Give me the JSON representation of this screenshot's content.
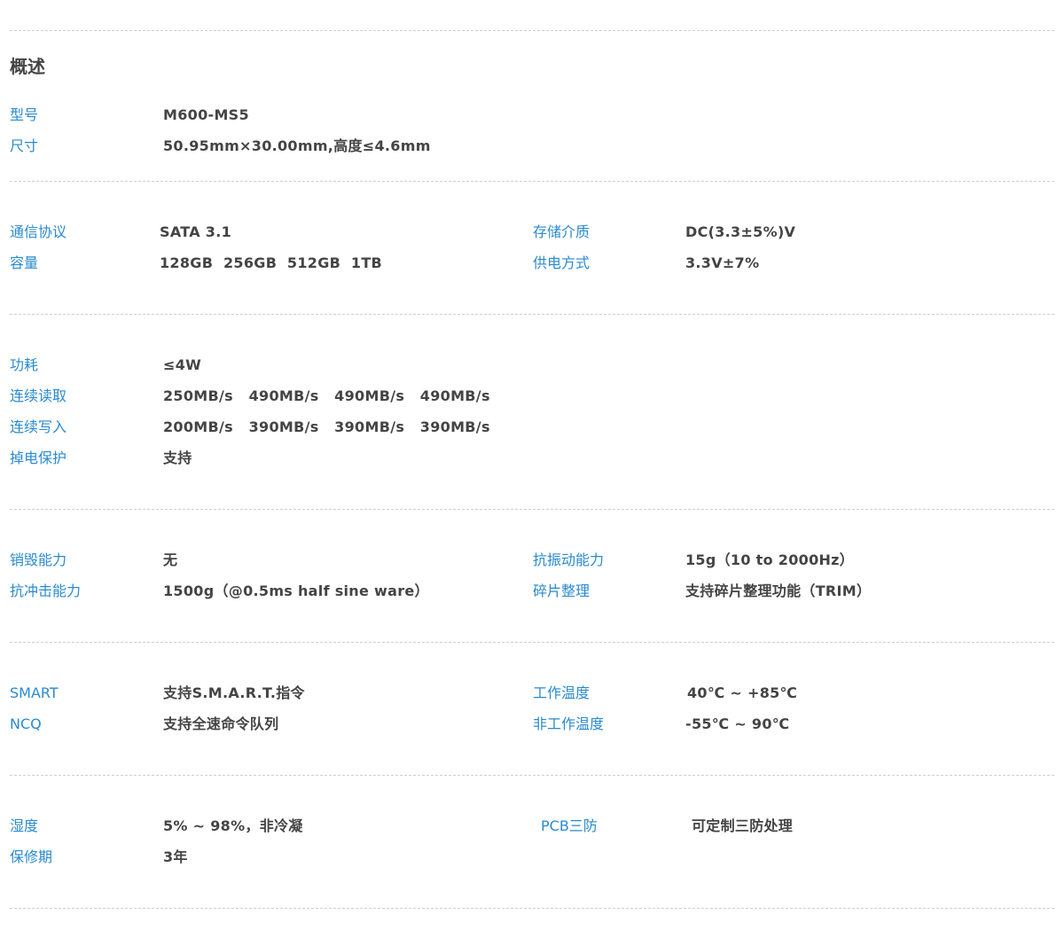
{
  "title": "概述",
  "colors": {
    "label": "#2a8ad0",
    "value": "#444444",
    "divider": "#cfcfcf"
  },
  "sections": [
    {
      "rows": [
        {
          "label": "型号",
          "value": "M600-MS5"
        },
        {
          "label": "尺寸",
          "value": "50.95mm×30.00mm,高度≤4.6mm"
        }
      ]
    },
    {
      "rows": [
        {
          "label": "通信协议",
          "value": "SATA 3.1"
        },
        {
          "label": "容量",
          "value": "128GB  256GB  512GB  1TB"
        }
      ],
      "right": [
        {
          "label": "存储介质",
          "value": "DC(3.3±5%)V"
        },
        {
          "label": "供电方式",
          "value": "3.3V±7%"
        }
      ]
    },
    {
      "rows": [
        {
          "label": "功耗",
          "value": "≤4W"
        },
        {
          "label": "连续读取",
          "value": "250MB/s   490MB/s   490MB/s   490MB/s"
        },
        {
          "label": "连续写入",
          "value": "200MB/s   390MB/s   390MB/s   390MB/s"
        },
        {
          "label": "掉电保护",
          "value": "支持"
        }
      ]
    },
    {
      "rows": [
        {
          "label": "销毁能力",
          "value": "无"
        },
        {
          "label": "抗冲击能力",
          "value": "1500g（@0.5ms half sine ware）"
        }
      ],
      "right": [
        {
          "label": "抗振动能力",
          "value": "15g（10 to 2000Hz）"
        },
        {
          "label": "碎片整理",
          "value": "支持碎片整理功能（TRIM）"
        }
      ]
    },
    {
      "rows": [
        {
          "label": "SMART",
          "value": "支持S.M.A.R.T.指令"
        },
        {
          "label": "NCQ",
          "value": "支持全速命令队列"
        }
      ],
      "right": [
        {
          "label": "工作温度",
          "value": "40℃ ~ +85℃"
        },
        {
          "label": "非工作温度",
          "value": "-55℃ ~ 90℃"
        }
      ]
    },
    {
      "rows": [
        {
          "label": "湿度",
          "value": "5% ~ 98%，非冷凝"
        },
        {
          "label": "保修期",
          "value": "3年"
        }
      ],
      "right": [
        {
          "label": "PCB三防",
          "value": "可定制三防处理"
        }
      ]
    }
  ]
}
